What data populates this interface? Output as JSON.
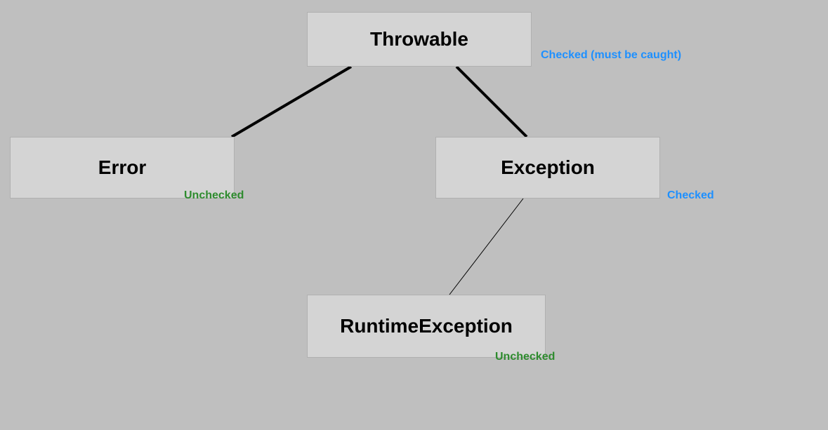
{
  "nodes": {
    "throwable": {
      "label": "Throwable",
      "annotation": "Checked (must be caught)",
      "annotation_type": "checked"
    },
    "error": {
      "label": "Error",
      "annotation": "Unchecked",
      "annotation_type": "unchecked"
    },
    "exception": {
      "label": "Exception",
      "annotation": "Checked",
      "annotation_type": "checked"
    },
    "runtime_exception": {
      "label": "RuntimeException",
      "annotation": "Unchecked",
      "annotation_type": "unchecked"
    }
  },
  "edges": [
    {
      "from": "throwable",
      "to": "error"
    },
    {
      "from": "throwable",
      "to": "exception"
    },
    {
      "from": "exception",
      "to": "runtime_exception"
    }
  ]
}
